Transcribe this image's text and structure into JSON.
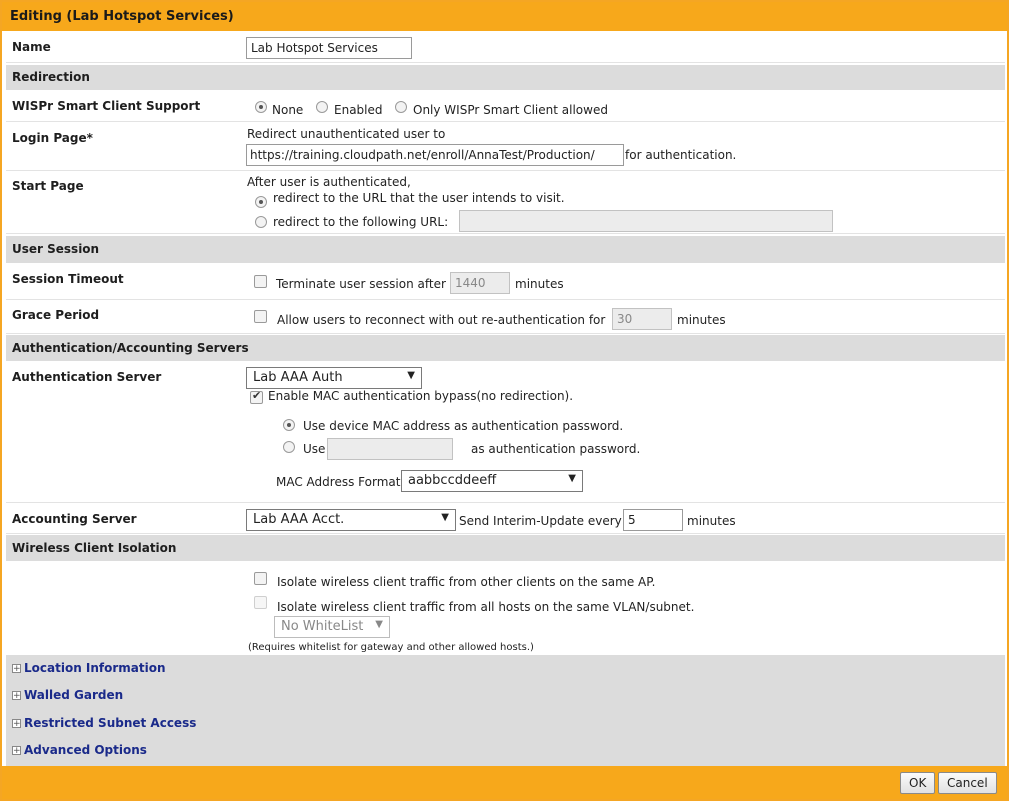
{
  "title": "Editing (Lab Hotspot Services)",
  "name": {
    "label": "Name",
    "value": "Lab Hotspot Services"
  },
  "redirection": {
    "header": "Redirection",
    "wispr": {
      "label": "WISPr Smart Client Support",
      "options": [
        "None",
        "Enabled",
        "Only WISPr Smart Client allowed"
      ],
      "selected": "None"
    },
    "login": {
      "label": "Login Page*",
      "text1": "Redirect unauthenticated user to",
      "url": "https://training.cloudpath.net/enroll/AnnaTest/Production/",
      "suffix": "for authentication."
    },
    "start": {
      "label": "Start Page",
      "text1": "After user is authenticated,",
      "opt1": "redirect to the URL that the user intends to visit.",
      "opt2": "redirect to the following URL:",
      "url": ""
    }
  },
  "session": {
    "header": "User Session",
    "timeout": {
      "label": "Session Timeout",
      "text": "Terminate user session after",
      "value": "1440",
      "unit": "minutes"
    },
    "grace": {
      "label": "Grace Period",
      "text": "Allow users to reconnect with out re-authentication for",
      "value": "30",
      "unit": "minutes"
    }
  },
  "servers": {
    "header": "Authentication/Accounting Servers",
    "auth": {
      "label": "Authentication Server",
      "selected": "Lab AAA Auth",
      "mac_bypass": "Enable MAC authentication bypass(no redirection).",
      "opt_device": "Use device MAC address as authentication password.",
      "opt_use": "Use",
      "opt_use_suffix": "as authentication password.",
      "mac_format_label": "MAC Address Format",
      "mac_format": "aabbccddeeff"
    },
    "acct": {
      "label": "Accounting Server",
      "selected": "Lab AAA Acct.",
      "interim_text": "Send Interim-Update every",
      "interim_value": "5",
      "unit": "minutes"
    }
  },
  "isolation": {
    "header": "Wireless Client Isolation",
    "opt1": "Isolate wireless client traffic from other clients on the same AP.",
    "opt2": "Isolate wireless client traffic from all hosts on the same VLAN/subnet.",
    "whitelist": "No WhiteList",
    "note": "(Requires whitelist for gateway and other allowed hosts.)"
  },
  "expanders": [
    "Location Information",
    "Walled Garden",
    "Restricted Subnet Access",
    "Advanced Options"
  ],
  "buttons": {
    "ok": "OK",
    "cancel": "Cancel"
  }
}
